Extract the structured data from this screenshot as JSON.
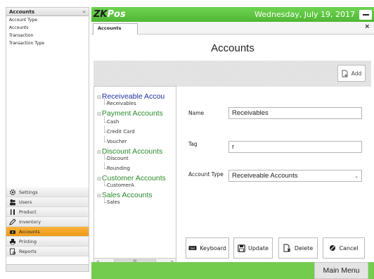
{
  "sidebar": {
    "title": "Accounts",
    "collapse_glyph": "«",
    "items": [
      {
        "label": "Account Type"
      },
      {
        "label": "Accounts"
      },
      {
        "label": "Transaction"
      },
      {
        "label": "Transaction Type"
      }
    ],
    "nav": [
      {
        "label": "Settings",
        "icon": "gear-icon"
      },
      {
        "label": "Users",
        "icon": "users-icon"
      },
      {
        "label": "Product",
        "icon": "fork-knife-icon"
      },
      {
        "label": "Inventory",
        "icon": "pencil-icon"
      },
      {
        "label": "Accounts",
        "icon": "money-icon",
        "active": true
      },
      {
        "label": "Printing",
        "icon": "printer-icon"
      },
      {
        "label": "Reports",
        "icon": "report-icon"
      }
    ]
  },
  "app": {
    "logo_prefix": "ZK",
    "logo_suffix": "Pos",
    "date": "Wednesday, July 19, 2017",
    "tab_label": "Accounts",
    "close_glyph": "×"
  },
  "page": {
    "title": "Accounts",
    "add_label": "Add"
  },
  "tree": {
    "groups": [
      {
        "label": "Receiveable Accou",
        "color": "#1f2fa3",
        "leaves": [
          "Receivables"
        ]
      },
      {
        "label": "Payment Accounts",
        "color": "#2a8a2a",
        "leaves": [
          "Cash",
          "Credit Card",
          "Voucher"
        ]
      },
      {
        "label": "Discount Accounts",
        "color": "#2a8a2a",
        "leaves": [
          "Discount",
          "Rounding"
        ]
      },
      {
        "label": "Customer Accounts",
        "color": "#2a8a2a",
        "leaves": [
          "CustomerA"
        ]
      },
      {
        "label": "Sales Accounts",
        "color": "#2a8a2a",
        "leaves": [
          "Sales"
        ]
      }
    ],
    "scroll_left": "<",
    "scroll_right": ">",
    "scroll_thumb": "III"
  },
  "form": {
    "name_label": "Name",
    "name_value": "Receivables",
    "tag_label": "Tag",
    "tag_value": "r",
    "type_label": "Account Type",
    "type_value": "Receiveable Accounts"
  },
  "actions": {
    "keyboard": "Keyboard",
    "update": "Update",
    "delete": "Delete",
    "cancel": "Cancel"
  },
  "footer": {
    "main_menu": "Main Menu"
  },
  "colors": {
    "titlebar_green": "#5bc43d",
    "active_orange": "#f2a527"
  }
}
